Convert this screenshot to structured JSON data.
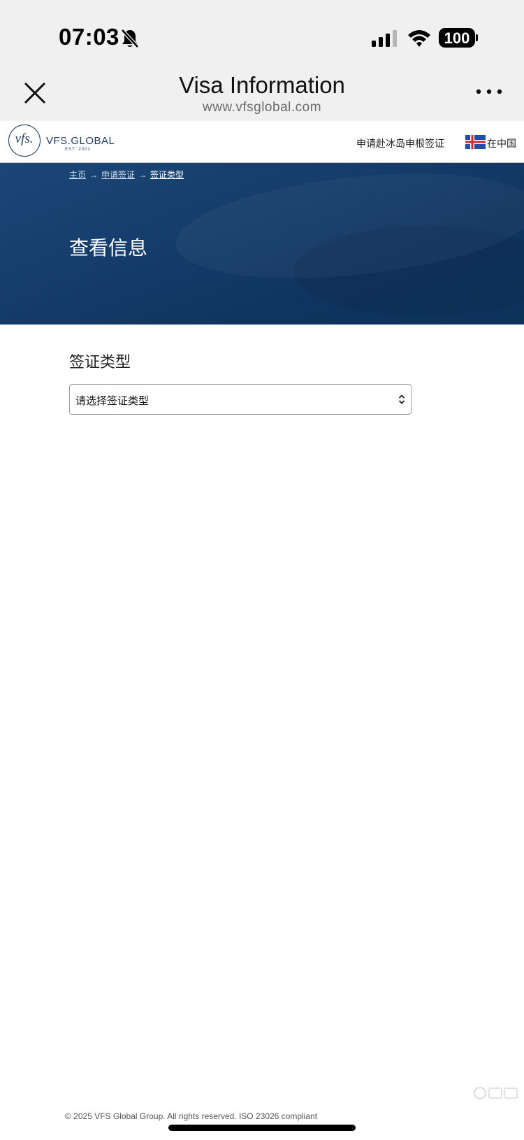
{
  "status_bar": {
    "time": "07:03",
    "battery": "100",
    "icons": [
      "bell-slash-icon",
      "signal-icon",
      "wifi-icon",
      "battery-icon"
    ]
  },
  "browser": {
    "title": "Visa Information",
    "url": "www.vfsglobal.com",
    "icons": [
      "close-icon",
      "more-icon"
    ]
  },
  "site_header": {
    "logo_mark": "vfs.",
    "logo_text": "VFS.GLOBAL",
    "logo_est": "EST. 2001",
    "apply_label": "申请赴冰岛申根签证",
    "flag_icon": "iceland-flag-icon",
    "region_label": "在中国"
  },
  "breadcrumb": {
    "items": [
      "主页",
      "申请签证",
      "签证类型"
    ],
    "separator": "→"
  },
  "hero": {
    "title": "查看信息"
  },
  "form": {
    "section_label": "签证类型",
    "select_value": "请选择签证类型"
  },
  "footer": {
    "copyright": "© 2025 VFS Global Group. All rights reserved. ISO 23026 compliant"
  },
  "colors": {
    "hero_bg": "#163e6c",
    "brand_navy": "#1f3b5c",
    "browser_chrome": "#f0f0f0"
  }
}
